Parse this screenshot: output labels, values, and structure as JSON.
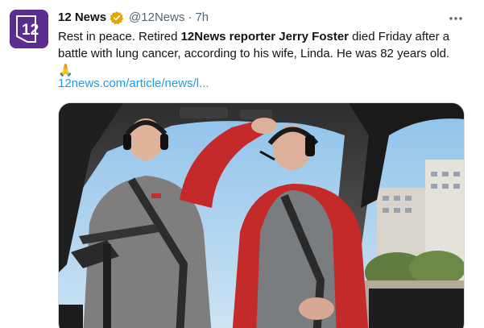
{
  "account": {
    "display_name": "12 News",
    "handle": "@12News",
    "separator": "·",
    "time": "7h",
    "avatar_icon": "12-news-logo-icon",
    "avatar_color": "#5b2d90",
    "verified_color": "#e8a400"
  },
  "tweet": {
    "text_part1": "Rest in peace. Retired ",
    "text_bold": "12News reporter Jerry Foster",
    "text_part2": " died Friday after a battle with lung cancer, according to his wife, Linda. He was 82 years old.",
    "emoji": "🙏",
    "link_text": "12news.com/article/news/l..."
  },
  "media": {
    "image_icon": "helicopter-cockpit-photo"
  },
  "colors": {
    "link": "#1d9bf0",
    "secondary_text": "#536471",
    "border": "#cfd9de"
  }
}
